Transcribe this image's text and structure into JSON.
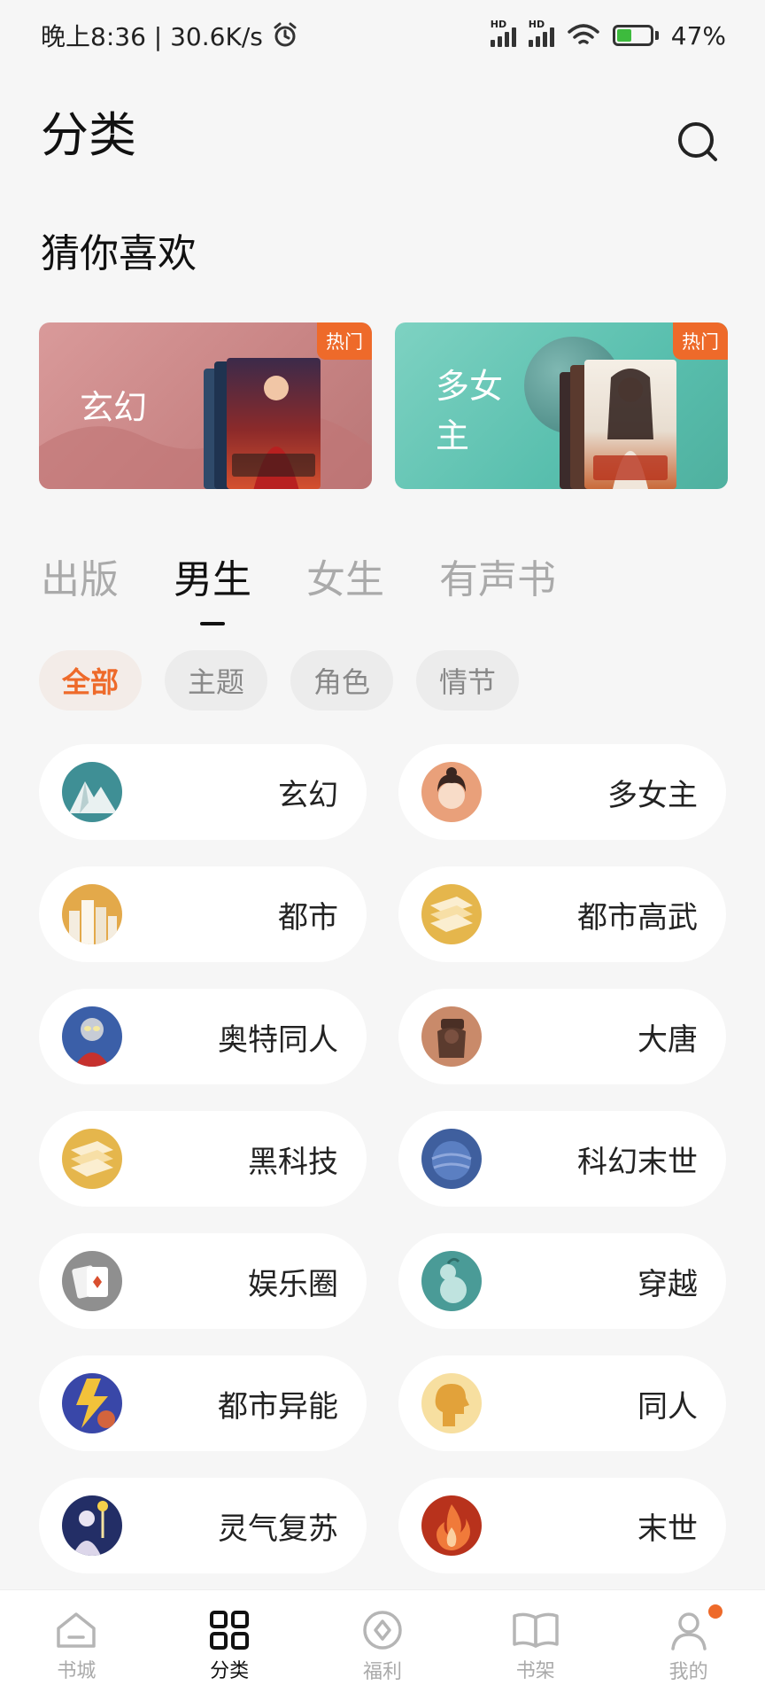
{
  "status": {
    "time_text": "晚上8:36 | 30.6K/s",
    "battery": "47%"
  },
  "header": {
    "title": "分类"
  },
  "recommend": {
    "title": "猜你喜欢",
    "banners": [
      {
        "label": "玄幻",
        "badge": "热门"
      },
      {
        "label": "多女主",
        "badge": "热门"
      }
    ]
  },
  "tabs": [
    "出版",
    "男生",
    "女生",
    "有声书"
  ],
  "active_tab": "男生",
  "filters": [
    "全部",
    "主题",
    "角色",
    "情节"
  ],
  "active_filter": "全部",
  "categories": [
    {
      "name": "玄幻",
      "icon": "mountain-icon"
    },
    {
      "name": "多女主",
      "icon": "woman-face-icon"
    },
    {
      "name": "都市",
      "icon": "city-icon"
    },
    {
      "name": "都市高武",
      "icon": "scroll-icon"
    },
    {
      "name": "奥特同人",
      "icon": "hero-icon"
    },
    {
      "name": "大唐",
      "icon": "tang-figure-icon"
    },
    {
      "name": "黑科技",
      "icon": "scroll-icon"
    },
    {
      "name": "科幻末世",
      "icon": "planet-icon"
    },
    {
      "name": "娱乐圈",
      "icon": "cards-icon"
    },
    {
      "name": "穿越",
      "icon": "gourd-icon"
    },
    {
      "name": "都市异能",
      "icon": "lightning-icon"
    },
    {
      "name": "同人",
      "icon": "profile-icon"
    },
    {
      "name": "灵气复苏",
      "icon": "mage-icon"
    },
    {
      "name": "末世",
      "icon": "fire-icon"
    }
  ],
  "nav": [
    {
      "label": "书城",
      "icon": "home-icon"
    },
    {
      "label": "分类",
      "icon": "grid-icon"
    },
    {
      "label": "福利",
      "icon": "coin-icon"
    },
    {
      "label": "书架",
      "icon": "book-icon"
    },
    {
      "label": "我的",
      "icon": "user-icon"
    }
  ],
  "colors": {
    "accent": "#ee6a2a",
    "background": "#f6f6f6",
    "card": "#ffffff"
  }
}
